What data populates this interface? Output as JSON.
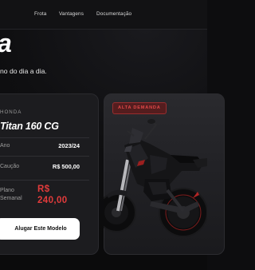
{
  "nav": {
    "items": [
      "Frota",
      "Vantagens",
      "Documentação"
    ]
  },
  "hero": {
    "title": "a",
    "subtitle": "no do dia a dia."
  },
  "card": {
    "brand": "HONDA",
    "model": "Titan 160 CG",
    "specs": {
      "year_label": "Ano",
      "year_value": "2023/24",
      "deposit_label": "Caução",
      "deposit_value": "R$ 500,00",
      "plan_label_line1": "Plano",
      "plan_label_line2": "Semanal",
      "price_line1": "R$",
      "price_line2": "240,00"
    },
    "cta_label": "Alugar Este Modelo"
  },
  "image_card": {
    "badge": "ALTA DEMANDA"
  },
  "colors": {
    "accent": "#e23b3b",
    "background": "#0d0d0f",
    "card": "#1c1c1f"
  }
}
